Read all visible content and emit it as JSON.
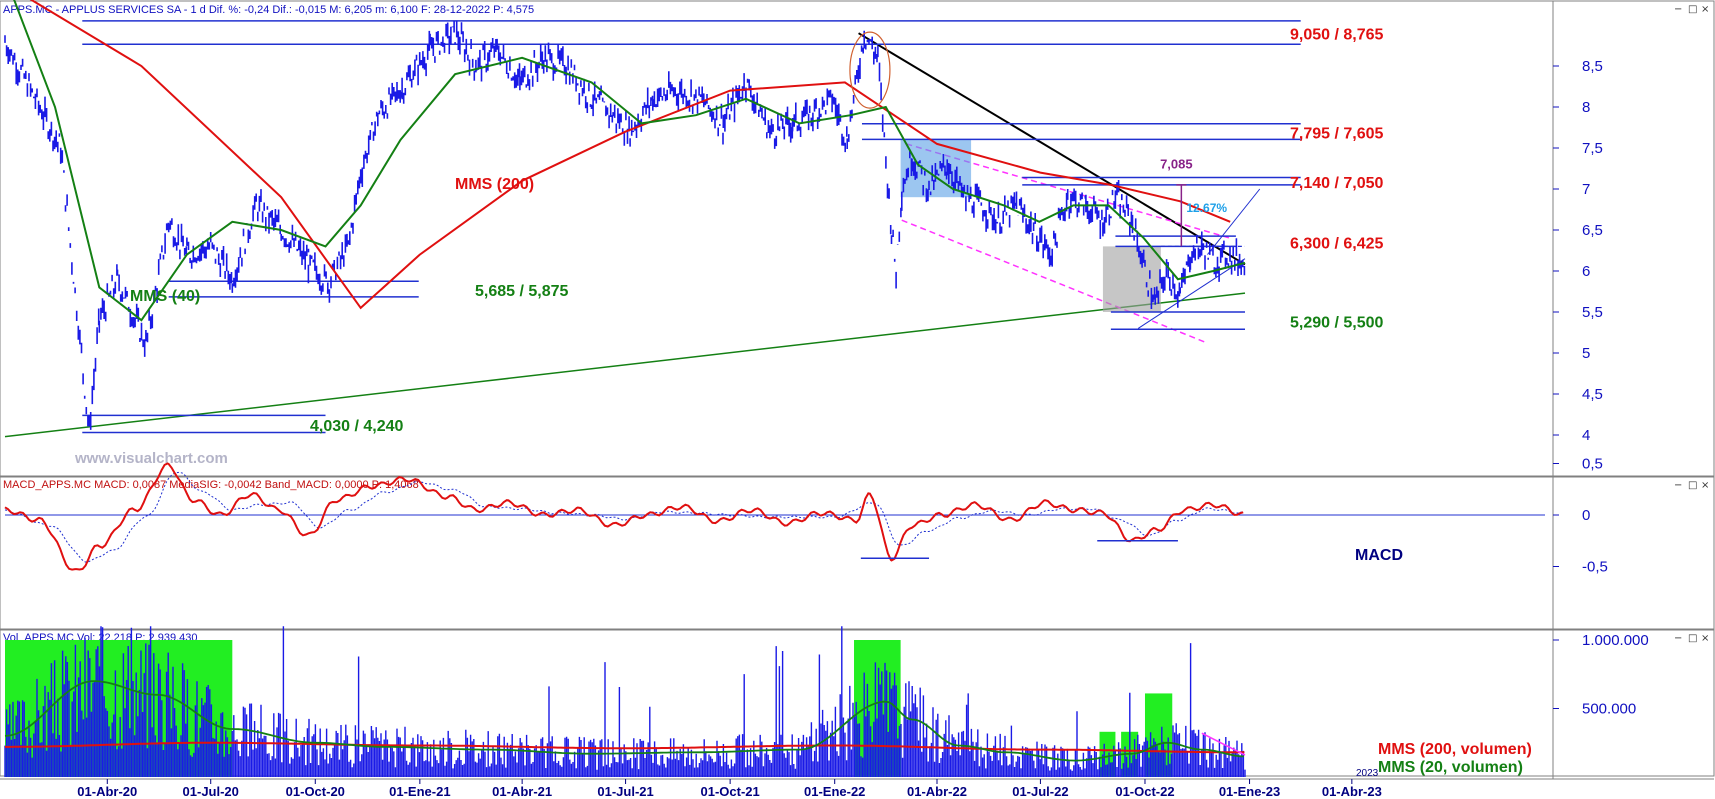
{
  "headers": {
    "price": "APPS.MC - APPLUS SERVICES SA -  1 d  Dif. %: -0,24  Dif.: -0,015  M: 6,205  m: 6,100  F: 28-12-2022  P: 4,575",
    "macd": "MACD_APPS.MC  MACD: 0,0087  MediaSIG: -0,0042  Band_MACD: 0,0000  P: 1,4068",
    "volume": "Vol_APPS.MC  Vol: 22.218  P: 2.939.430"
  },
  "watermark": "www.visualchart.com",
  "window_icons": {
    "minimize": "−",
    "maximize": "□",
    "close": "×"
  },
  "colors": {
    "price": "#1a1ae6",
    "mms200": "#e01010",
    "mms40": "#148014",
    "trend": "#000000",
    "support": "#148014",
    "channel": "#ff33ff",
    "axis_text": "#1010c0",
    "level_red": "#e01010",
    "level_green": "#148014",
    "box_blue": "#5aa0e6",
    "box_grey": "#a0a0a0",
    "vol_green": "#22ee22"
  },
  "chart_data": [
    {
      "type": "line",
      "panel": "price",
      "y_ticks": [
        "8,5",
        "8",
        "7,5",
        "7",
        "6,5",
        "6",
        "5,5",
        "5",
        "4,5",
        "4"
      ],
      "ylim": [
        3.6,
        9.3
      ],
      "x_ticks": [
        "01-Abr-20",
        "01-Jul-20",
        "01-Oct-20",
        "01-Ene-21",
        "01-Abr-21",
        "01-Jul-21",
        "01-Oct-21",
        "01-Ene-22",
        "01-Abr-22",
        "01-Jul-22",
        "01-Oct-22",
        "01-Ene-23",
        "01-Abr-23"
      ],
      "x_tick_short": "2023",
      "series": [
        {
          "name": "",
          "role": "price",
          "x": [
            "2020-01-02",
            "2020-02-20",
            "2020-03-16",
            "2020-03-25",
            "2020-04-10",
            "2020-05-05",
            "2020-05-25",
            "2020-06-10",
            "2020-07-01",
            "2020-07-20",
            "2020-08-10",
            "2020-09-01",
            "2020-09-25",
            "2020-10-12",
            "2020-10-30",
            "2020-11-10",
            "2020-11-25",
            "2020-12-15",
            "2021-01-10",
            "2021-02-01",
            "2021-02-20",
            "2021-03-10",
            "2021-03-30",
            "2021-04-20",
            "2021-05-10",
            "2021-06-01",
            "2021-06-20",
            "2021-07-05",
            "2021-07-25",
            "2021-08-15",
            "2021-09-05",
            "2021-09-25",
            "2021-10-15",
            "2021-11-05",
            "2021-11-25",
            "2021-12-10",
            "2021-12-30",
            "2022-01-12",
            "2022-01-27",
            "2022-02-08",
            "2022-02-20",
            "2022-02-24",
            "2022-03-01",
            "2022-03-10",
            "2022-03-25",
            "2022-04-10",
            "2022-04-25",
            "2022-05-10",
            "2022-05-25",
            "2022-06-10",
            "2022-06-25",
            "2022-07-10",
            "2022-07-25",
            "2022-08-10",
            "2022-08-25",
            "2022-09-05",
            "2022-09-20",
            "2022-10-01",
            "2022-10-10",
            "2022-10-20",
            "2022-11-01",
            "2022-11-10",
            "2022-11-20",
            "2022-12-01",
            "2022-12-12",
            "2022-12-28"
          ],
          "values": [
            8.8,
            7.5,
            4.05,
            5.4,
            5.9,
            5.1,
            6.6,
            6.2,
            6.3,
            5.9,
            6.8,
            6.5,
            6.1,
            5.85,
            6.3,
            7.2,
            7.9,
            8.2,
            8.7,
            8.9,
            8.5,
            8.7,
            8.3,
            8.6,
            8.5,
            8.1,
            7.9,
            7.7,
            8.1,
            8.2,
            8.1,
            7.8,
            8.3,
            7.7,
            7.8,
            7.9,
            8.1,
            7.6,
            8.9,
            8.6,
            6.5,
            6.0,
            7.0,
            7.4,
            7.0,
            7.3,
            6.9,
            6.8,
            6.6,
            6.8,
            6.5,
            6.2,
            6.9,
            6.8,
            6.6,
            6.9,
            6.6,
            6.0,
            5.6,
            6.0,
            5.7,
            6.2,
            6.3,
            6.1,
            6.2,
            6.1
          ]
        },
        {
          "name": "MMS (200)",
          "role": "mms200",
          "x": [
            "2020-01-02",
            "2020-05-01",
            "2020-09-01",
            "2020-11-10",
            "2021-01-01",
            "2021-04-01",
            "2021-07-01",
            "2021-10-01",
            "2022-01-10",
            "2022-04-01",
            "2022-07-01",
            "2022-09-01",
            "2022-11-01",
            "2022-12-15"
          ],
          "values": [
            9.5,
            8.5,
            6.9,
            5.55,
            6.2,
            7.1,
            7.7,
            8.2,
            8.3,
            7.55,
            7.2,
            7.05,
            6.85,
            6.6
          ]
        },
        {
          "name": "MMS (40)",
          "role": "mms40",
          "x": [
            "2020-01-02",
            "2020-02-15",
            "2020-03-25",
            "2020-05-01",
            "2020-06-10",
            "2020-07-20",
            "2020-09-01",
            "2020-10-10",
            "2020-11-10",
            "2020-12-15",
            "2021-02-01",
            "2021-04-01",
            "2021-06-01",
            "2021-07-15",
            "2021-09-01",
            "2021-10-15",
            "2021-12-01",
            "2022-01-15",
            "2022-02-15",
            "2022-03-15",
            "2022-04-15",
            "2022-05-30",
            "2022-06-30",
            "2022-07-30",
            "2022-08-30",
            "2022-09-30",
            "2022-10-30",
            "2022-11-30",
            "2022-12-28"
          ],
          "values": [
            9.6,
            8.0,
            5.8,
            5.4,
            6.2,
            6.6,
            6.5,
            6.3,
            6.8,
            7.6,
            8.4,
            8.6,
            8.3,
            7.8,
            7.9,
            8.1,
            7.8,
            7.9,
            8.0,
            7.3,
            7.0,
            6.8,
            6.6,
            6.8,
            6.8,
            6.4,
            5.9,
            6.0,
            6.1
          ]
        }
      ],
      "levels": [
        {
          "label": "9,050 / 8,765",
          "color": "red",
          "values": [
            9.05,
            8.765
          ]
        },
        {
          "label": "7,795 / 7,605",
          "color": "red",
          "values": [
            7.795,
            7.605
          ]
        },
        {
          "label": "7,140 / 7,050",
          "color": "red",
          "values": [
            7.14,
            7.05
          ]
        },
        {
          "label": "6,300 / 6,425",
          "color": "red",
          "values": [
            6.3,
            6.425
          ]
        },
        {
          "label": "5,685 / 5,875",
          "color": "green",
          "values": [
            5.685,
            5.875
          ]
        },
        {
          "label": "5,290 / 5,500",
          "color": "green",
          "values": [
            5.29,
            5.5
          ]
        },
        {
          "label": "4,030 / 4,240",
          "color": "green",
          "values": [
            4.03,
            4.24
          ]
        }
      ],
      "annotations": {
        "peak": "7,085",
        "pct": "12.67%"
      }
    },
    {
      "type": "line",
      "panel": "macd",
      "y_ticks": [
        "0,5",
        "0",
        "-0,5"
      ],
      "ylim": [
        -0.58,
        0.62
      ],
      "label": "MACD",
      "series": [
        {
          "name": "",
          "role": "macd",
          "x": [
            "2020-01-02",
            "2020-02-01",
            "2020-03-05",
            "2020-03-25",
            "2020-04-25",
            "2020-05-25",
            "2020-06-15",
            "2020-07-10",
            "2020-08-05",
            "2020-08-30",
            "2020-09-25",
            "2020-10-20",
            "2020-11-20",
            "2020-12-20",
            "2021-01-25",
            "2021-02-20",
            "2021-03-20",
            "2021-04-20",
            "2021-05-20",
            "2021-06-20",
            "2021-07-20",
            "2021-08-20",
            "2021-09-20",
            "2021-10-20",
            "2021-11-20",
            "2021-12-20",
            "2022-01-20",
            "2022-02-01",
            "2022-02-20",
            "2022-03-10",
            "2022-04-05",
            "2022-05-05",
            "2022-06-05",
            "2022-07-05",
            "2022-07-30",
            "2022-08-25",
            "2022-09-20",
            "2022-10-10",
            "2022-11-05",
            "2022-11-30",
            "2022-12-28"
          ],
          "values": [
            0.05,
            -0.05,
            -0.55,
            -0.3,
            0.05,
            0.48,
            0.15,
            0.0,
            0.2,
            0.05,
            -0.2,
            0.15,
            0.28,
            0.35,
            0.18,
            0.05,
            0.12,
            0.0,
            0.05,
            -0.1,
            0.0,
            0.08,
            -0.06,
            0.05,
            -0.08,
            0.02,
            -0.05,
            0.2,
            -0.42,
            -0.1,
            0.0,
            0.1,
            -0.05,
            0.12,
            0.05,
            0.02,
            -0.25,
            -0.15,
            0.05,
            0.1,
            0.0
          ]
        },
        {
          "name": "",
          "role": "signal",
          "x": [
            "2020-01-02",
            "2020-02-10",
            "2020-03-15",
            "2020-04-05",
            "2020-05-05",
            "2020-06-01",
            "2020-06-25",
            "2020-07-20",
            "2020-08-15",
            "2020-09-10",
            "2020-10-05",
            "2020-11-01",
            "2020-12-01",
            "2021-01-01",
            "2021-02-01",
            "2021-03-01",
            "2021-04-01",
            "2021-05-01",
            "2021-06-01",
            "2021-07-01",
            "2021-08-01",
            "2021-09-01",
            "2021-10-01",
            "2021-11-01",
            "2021-12-01",
            "2022-01-01",
            "2022-02-05",
            "2022-02-28",
            "2022-03-25",
            "2022-04-20",
            "2022-05-20",
            "2022-06-20",
            "2022-07-20",
            "2022-08-15",
            "2022-09-10",
            "2022-10-05",
            "2022-10-30",
            "2022-11-25",
            "2022-12-28"
          ],
          "values": [
            0.04,
            -0.1,
            -0.45,
            -0.35,
            -0.02,
            0.42,
            0.22,
            0.05,
            0.1,
            0.12,
            -0.12,
            0.05,
            0.22,
            0.32,
            0.24,
            0.08,
            0.06,
            0.02,
            0.0,
            -0.04,
            0.03,
            0.02,
            0.0,
            -0.02,
            -0.02,
            -0.02,
            0.12,
            -0.3,
            -0.15,
            -0.03,
            0.04,
            0.0,
            0.06,
            0.06,
            -0.05,
            -0.2,
            -0.05,
            0.06,
            0.02
          ]
        }
      ],
      "marks": [
        {
          "x": [
            "2022-01-24",
            "2022-03-25"
          ],
          "value": -0.42
        },
        {
          "x": [
            "2022-08-20",
            "2022-10-30"
          ],
          "value": -0.25
        }
      ]
    },
    {
      "type": "bar",
      "panel": "volume",
      "y_ticks": [
        "1.000.000",
        "500.000"
      ],
      "ylim": [
        0,
        1120000
      ],
      "series_labels": [
        "MMS (200, volumen)",
        "MMS (20, volumen)"
      ],
      "series": [
        {
          "name": "MMS (200, volumen)",
          "role": "vol200",
          "x": [
            "2020-01-02",
            "2020-07-01",
            "2021-01-01",
            "2021-07-01",
            "2022-01-01",
            "2022-07-01",
            "2022-12-28"
          ],
          "values": [
            220000,
            250000,
            230000,
            210000,
            230000,
            200000,
            180000
          ]
        },
        {
          "name": "MMS (20, volumen)",
          "role": "vol20",
          "x": [
            "2020-01-02",
            "2020-03-20",
            "2020-05-15",
            "2020-07-20",
            "2020-10-01",
            "2020-12-01",
            "2021-03-01",
            "2021-06-01",
            "2021-09-01",
            "2021-12-01",
            "2022-02-15",
            "2022-03-10",
            "2022-04-20",
            "2022-06-01",
            "2022-08-01",
            "2022-09-20",
            "2022-10-20",
            "2022-11-20",
            "2022-12-28"
          ],
          "values": [
            300000,
            700000,
            600000,
            350000,
            250000,
            220000,
            200000,
            170000,
            180000,
            200000,
            550000,
            420000,
            230000,
            180000,
            120000,
            170000,
            250000,
            200000,
            150000
          ]
        }
      ],
      "highlights": [
        {
          "from": "2020-01-02",
          "to": "2020-07-20",
          "value": 1000000
        },
        {
          "from": "2022-01-18",
          "to": "2022-02-28",
          "value": 1000000
        },
        {
          "from": "2022-08-22",
          "to": "2022-09-05",
          "value": 330000
        },
        {
          "from": "2022-09-10",
          "to": "2022-09-25",
          "value": 330000
        },
        {
          "from": "2022-10-01",
          "to": "2022-10-25",
          "value": 610000
        }
      ]
    }
  ]
}
